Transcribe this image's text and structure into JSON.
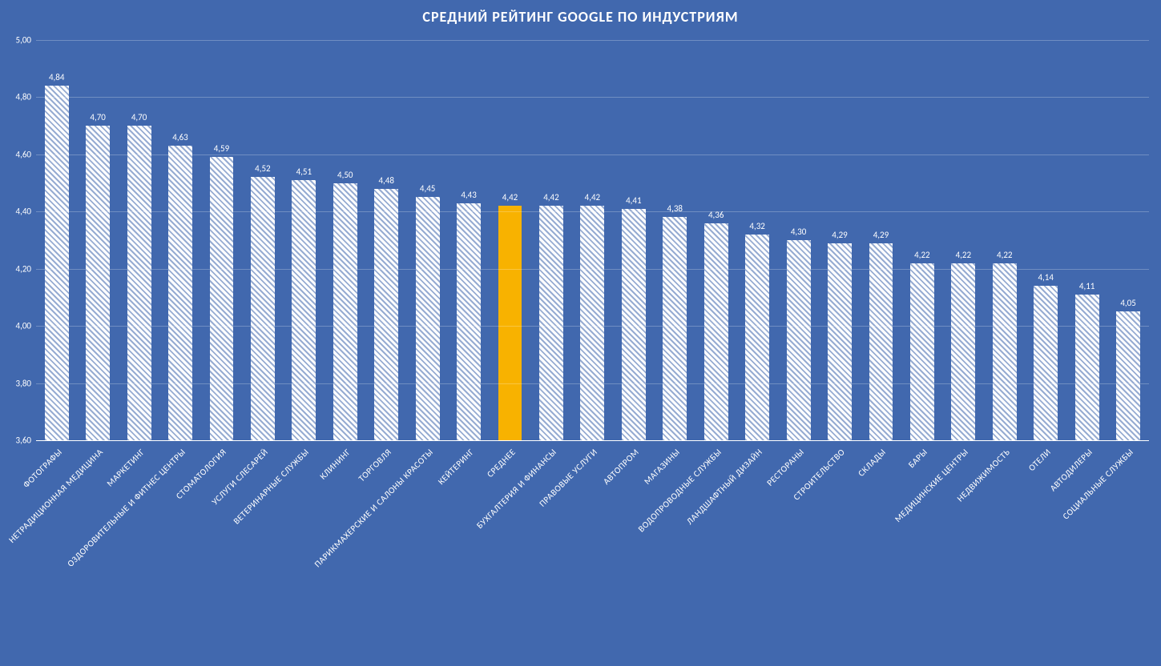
{
  "chart_data": {
    "type": "bar",
    "title": "СРЕДНИЙ РЕЙТИНГ GOOGLE ПО ИНДУСТРИЯМ",
    "xlabel": "",
    "ylabel": "",
    "ylim": [
      3.6,
      5.0
    ],
    "y_ticks": [
      3.6,
      3.8,
      4.0,
      4.2,
      4.4,
      4.6,
      4.8,
      5.0
    ],
    "y_tick_labels": [
      "3,60",
      "3,80",
      "4,00",
      "4,20",
      "4,40",
      "4,60",
      "4,80",
      "5,00"
    ],
    "highlight_index": 11,
    "categories": [
      "ФОТОГРАФЫ",
      "НЕТРАДИЦИОННАЯ МЕДИЦИНА",
      "МАРКЕТИНГ",
      "ОЗДОРОВИТЕЛЬНЫЕ И ФИТНЕС ЦЕНТРЫ",
      "СТОМАТОЛОГИЯ",
      "УСЛУГИ СЛЕСАРЕЙ",
      "ВЕТЕРИНАРНЫЕ СЛУЖБЫ",
      "КЛИНИНГ",
      "ТОРГОВЛЯ",
      "ПАРИКМАХЕРСКИЕ И САЛОНЫ КРАСОТЫ",
      "КЕЙТЕРИНГ",
      "СРЕДНЕЕ",
      "БУХГАЛТЕРИЯ И ФИНАНСЫ",
      "ПРАВОВЫЕ УСЛУГИ",
      "АВТОПРОМ",
      "МАГАЗИНЫ",
      "ВОДОПРОВОДНЫЕ СЛУЖБЫ",
      "ЛАНДШАФТНЫЙ ДИЗАЙН",
      "РЕСТОРАНЫ",
      "СТРОИТЕЛЬСТВО",
      "СКЛАДЫ",
      "БАРЫ",
      "МЕДИЦИНСКИЕ ЦЕНТРЫ",
      "НЕДВИЖИМОСТЬ",
      "ОТЕЛИ",
      "АВТОДИЛЕРЫ",
      "СОЦИАЛЬНЫЕ СЛУЖБЫ"
    ],
    "values": [
      4.84,
      4.7,
      4.7,
      4.63,
      4.59,
      4.52,
      4.51,
      4.5,
      4.48,
      4.45,
      4.43,
      4.42,
      4.42,
      4.42,
      4.41,
      4.38,
      4.36,
      4.32,
      4.3,
      4.29,
      4.29,
      4.22,
      4.22,
      4.22,
      4.14,
      4.11,
      4.05
    ],
    "value_labels": [
      "4,84",
      "4,70",
      "4,70",
      "4,63",
      "4,59",
      "4,52",
      "4,51",
      "4,50",
      "4,48",
      "4,45",
      "4,43",
      "4,42",
      "4,42",
      "4,42",
      "4,41",
      "4,38",
      "4,36",
      "4,32",
      "4,30",
      "4,29",
      "4,29",
      "4,22",
      "4,22",
      "4,22",
      "4,14",
      "4,11",
      "4,05"
    ]
  }
}
